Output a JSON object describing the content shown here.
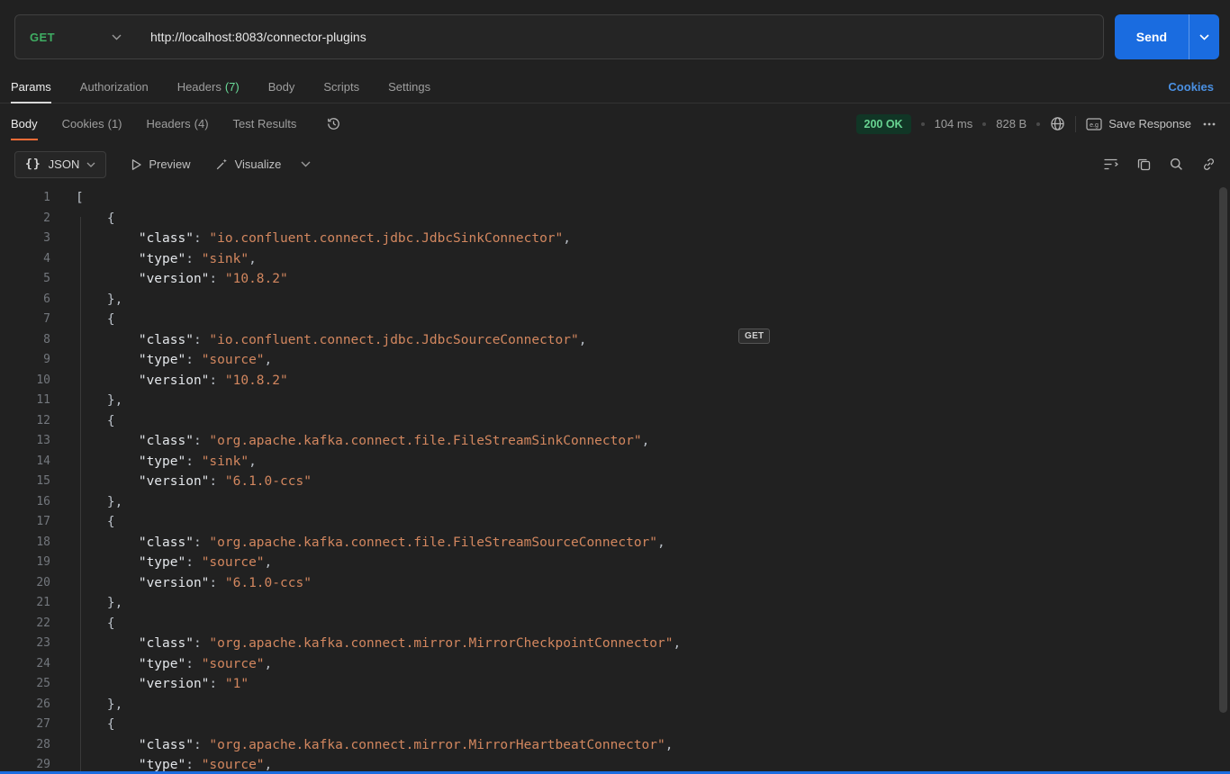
{
  "request_bar": {
    "method": "GET",
    "url": "http://localhost:8083/connector-plugins",
    "send_label": "Send"
  },
  "request_tabs": [
    {
      "label": "Params"
    },
    {
      "label": "Authorization"
    },
    {
      "label": "Headers",
      "count": "(7)"
    },
    {
      "label": "Body"
    },
    {
      "label": "Scripts"
    },
    {
      "label": "Settings"
    }
  ],
  "cookies_link": "Cookies",
  "response_tabs": [
    {
      "label": "Body"
    },
    {
      "label": "Cookies",
      "count": "(1)"
    },
    {
      "label": "Headers",
      "count": "(4)"
    },
    {
      "label": "Test Results"
    }
  ],
  "response_meta": {
    "status": "200 OK",
    "time": "104 ms",
    "size": "828 B",
    "save_label": "Save Response"
  },
  "viewer_toolbar": {
    "braces": "{}",
    "format_label": "JSON",
    "preview_label": "Preview",
    "visualize_label": "Visualize"
  },
  "overlay": {
    "method_tooltip": "GET"
  },
  "colors": {
    "method_green": "#3fad63",
    "send_blue": "#1a6ce0",
    "accent_orange": "#ff6c37",
    "status_green": "#67d391",
    "string_orange": "#d3875f",
    "link_blue": "#4a90e2"
  },
  "code": {
    "lines": [
      {
        "t": "["
      },
      {
        "t": "    {"
      },
      {
        "k": "class",
        "v": "io.confluent.connect.jdbc.JdbcSinkConnector",
        "c": true
      },
      {
        "k": "type",
        "v": "sink",
        "c": true
      },
      {
        "k": "version",
        "v": "10.8.2",
        "c": false
      },
      {
        "t": "    },"
      },
      {
        "t": "    {"
      },
      {
        "k": "class",
        "v": "io.confluent.connect.jdbc.JdbcSourceConnector",
        "c": true
      },
      {
        "k": "type",
        "v": "source",
        "c": true
      },
      {
        "k": "version",
        "v": "10.8.2",
        "c": false
      },
      {
        "t": "    },"
      },
      {
        "t": "    {"
      },
      {
        "k": "class",
        "v": "org.apache.kafka.connect.file.FileStreamSinkConnector",
        "c": true
      },
      {
        "k": "type",
        "v": "sink",
        "c": true
      },
      {
        "k": "version",
        "v": "6.1.0-ccs",
        "c": false
      },
      {
        "t": "    },"
      },
      {
        "t": "    {"
      },
      {
        "k": "class",
        "v": "org.apache.kafka.connect.file.FileStreamSourceConnector",
        "c": true
      },
      {
        "k": "type",
        "v": "source",
        "c": true
      },
      {
        "k": "version",
        "v": "6.1.0-ccs",
        "c": false
      },
      {
        "t": "    },"
      },
      {
        "t": "    {"
      },
      {
        "k": "class",
        "v": "org.apache.kafka.connect.mirror.MirrorCheckpointConnector",
        "c": true
      },
      {
        "k": "type",
        "v": "source",
        "c": true
      },
      {
        "k": "version",
        "v": "1",
        "c": false
      },
      {
        "t": "    },"
      },
      {
        "t": "    {"
      },
      {
        "k": "class",
        "v": "org.apache.kafka.connect.mirror.MirrorHeartbeatConnector",
        "c": true
      },
      {
        "k": "type",
        "v": "source",
        "c": true
      }
    ]
  }
}
